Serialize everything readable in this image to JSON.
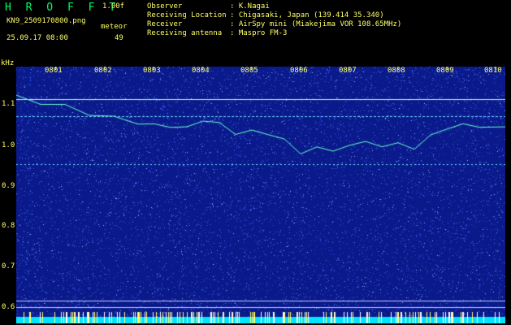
{
  "header": {
    "app_title": "H R O F F T",
    "version": "1.00f",
    "file_name": "KN9_2509170800.png",
    "meteor_label": "meteor",
    "meteor_count": "49",
    "datetime": "25.09.17 08:00",
    "info": [
      {
        "key": "Observer",
        "value": ": K.Nagai"
      },
      {
        "key": "Receiving Location",
        "value": ": Chigasaki, Japan (139.414 35.340)"
      },
      {
        "key": "Receiver",
        "value": ": AirSpy mini (Miakejima VOR 108.65MHz)"
      },
      {
        "key": "Receiving antenna",
        "value": ": Maspro FM-3"
      }
    ]
  },
  "axis": {
    "y_unit": "kHz",
    "y_ticks": [
      "1.1",
      "1.0",
      "0.9",
      "0.8",
      "0.7",
      "0.6"
    ],
    "x_ticks": [
      "0801",
      "0802",
      "0803",
      "0804",
      "0805",
      "0806",
      "0807",
      "0808",
      "0809",
      "0810"
    ]
  },
  "colors": {
    "background": "#000000",
    "plot_bg": "#0a1a8a",
    "text": "#ffff66",
    "title": "#00ff66",
    "trace": "#66ffcc",
    "noise": "#4d6cff",
    "baseline": "#00e5ff"
  }
}
